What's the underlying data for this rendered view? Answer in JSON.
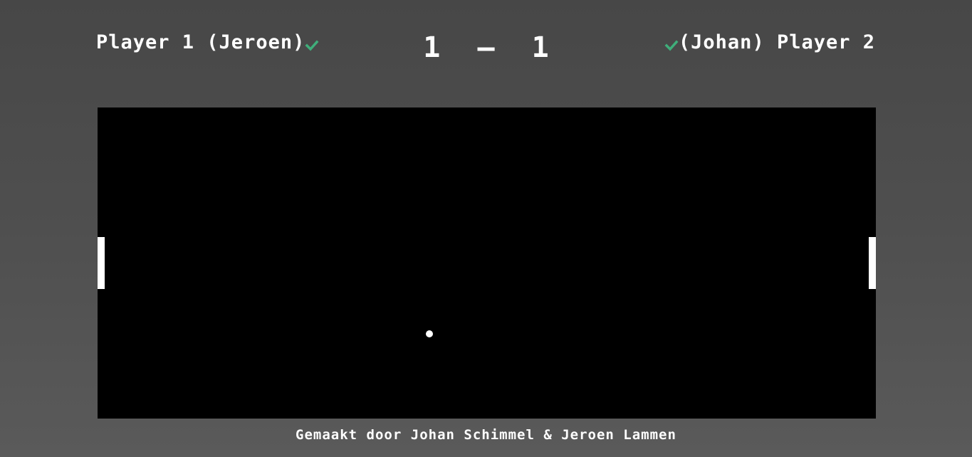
{
  "header": {
    "player1_label": "Player 1 (Jeroen)",
    "player2_label": "(Johan) Player 2",
    "player1_ready": true,
    "player2_ready": true,
    "ready_color": "#3fae7a"
  },
  "score": {
    "player1": "1",
    "separator": "–",
    "player2": "1"
  },
  "board": {
    "background_color": "#000000",
    "paddle_color": "#ffffff",
    "ball_color": "#ffffff"
  },
  "footer": {
    "credits": "Gemaakt door Johan Schimmel & Jeroen Lammen"
  }
}
